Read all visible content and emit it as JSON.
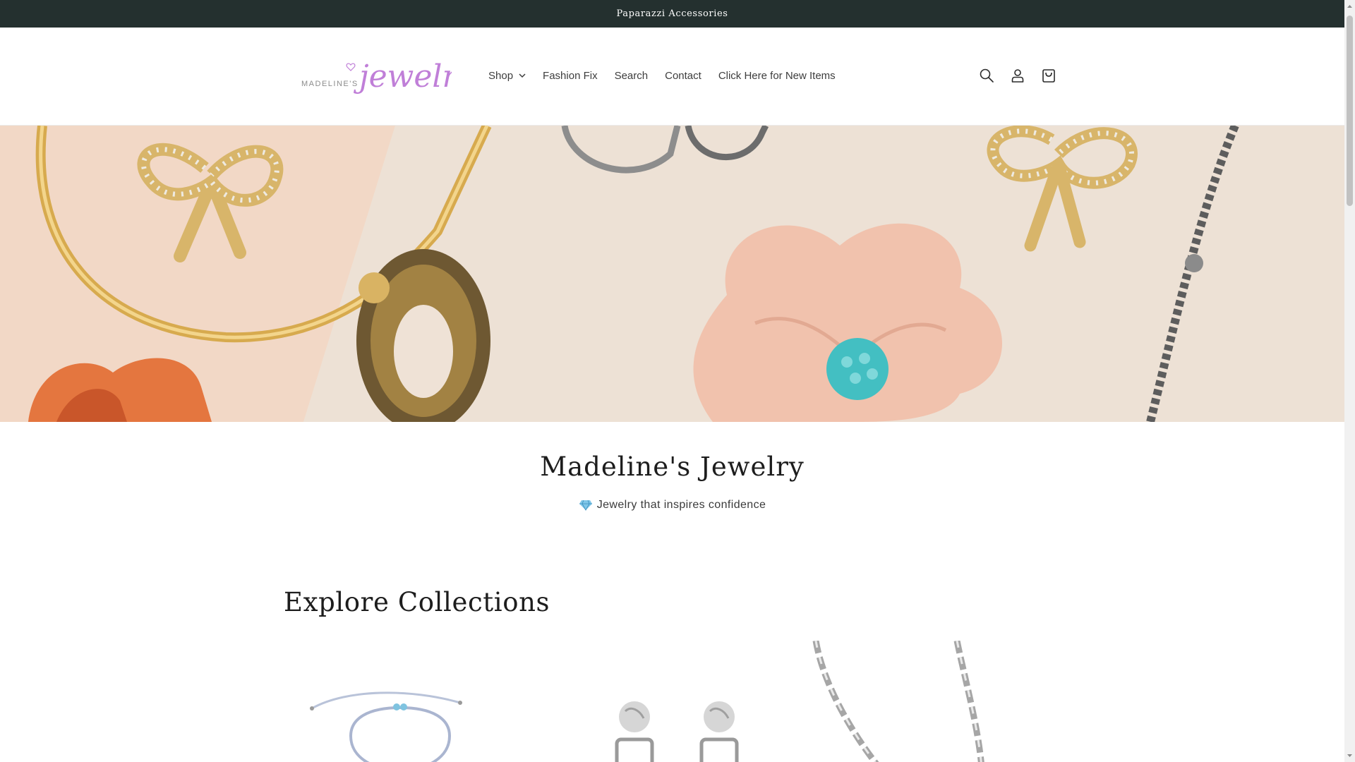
{
  "announcement": {
    "text": "Paparazzi Accessories"
  },
  "header": {
    "logo_alt": "Madeline's Jewelry",
    "logo_small": "MADELINE'S",
    "logo_script": "jewelry",
    "nav": [
      {
        "label": "Shop",
        "has_dropdown": true
      },
      {
        "label": "Fashion Fix"
      },
      {
        "label": "Search"
      },
      {
        "label": "Contact"
      },
      {
        "label": "Click Here for New Items"
      }
    ],
    "icons": [
      "search-icon",
      "account-icon",
      "cart-icon"
    ]
  },
  "hero": {
    "image_subject": "jewelry-flatlay"
  },
  "intro": {
    "title": "Madeline's Jewelry",
    "subtitle": "Jewelry that inspires confidence",
    "emoji": "gem-icon"
  },
  "collections": {
    "title": "Explore Collections",
    "cards": [
      {
        "image_subject": "bracelet"
      },
      {
        "image_subject": "earrings"
      },
      {
        "image_subject": "chain-necklace"
      }
    ]
  },
  "colors": {
    "announcement_bg": "#24302f",
    "logo_purple": "#c07fd8",
    "text": "#3d3d3d"
  }
}
